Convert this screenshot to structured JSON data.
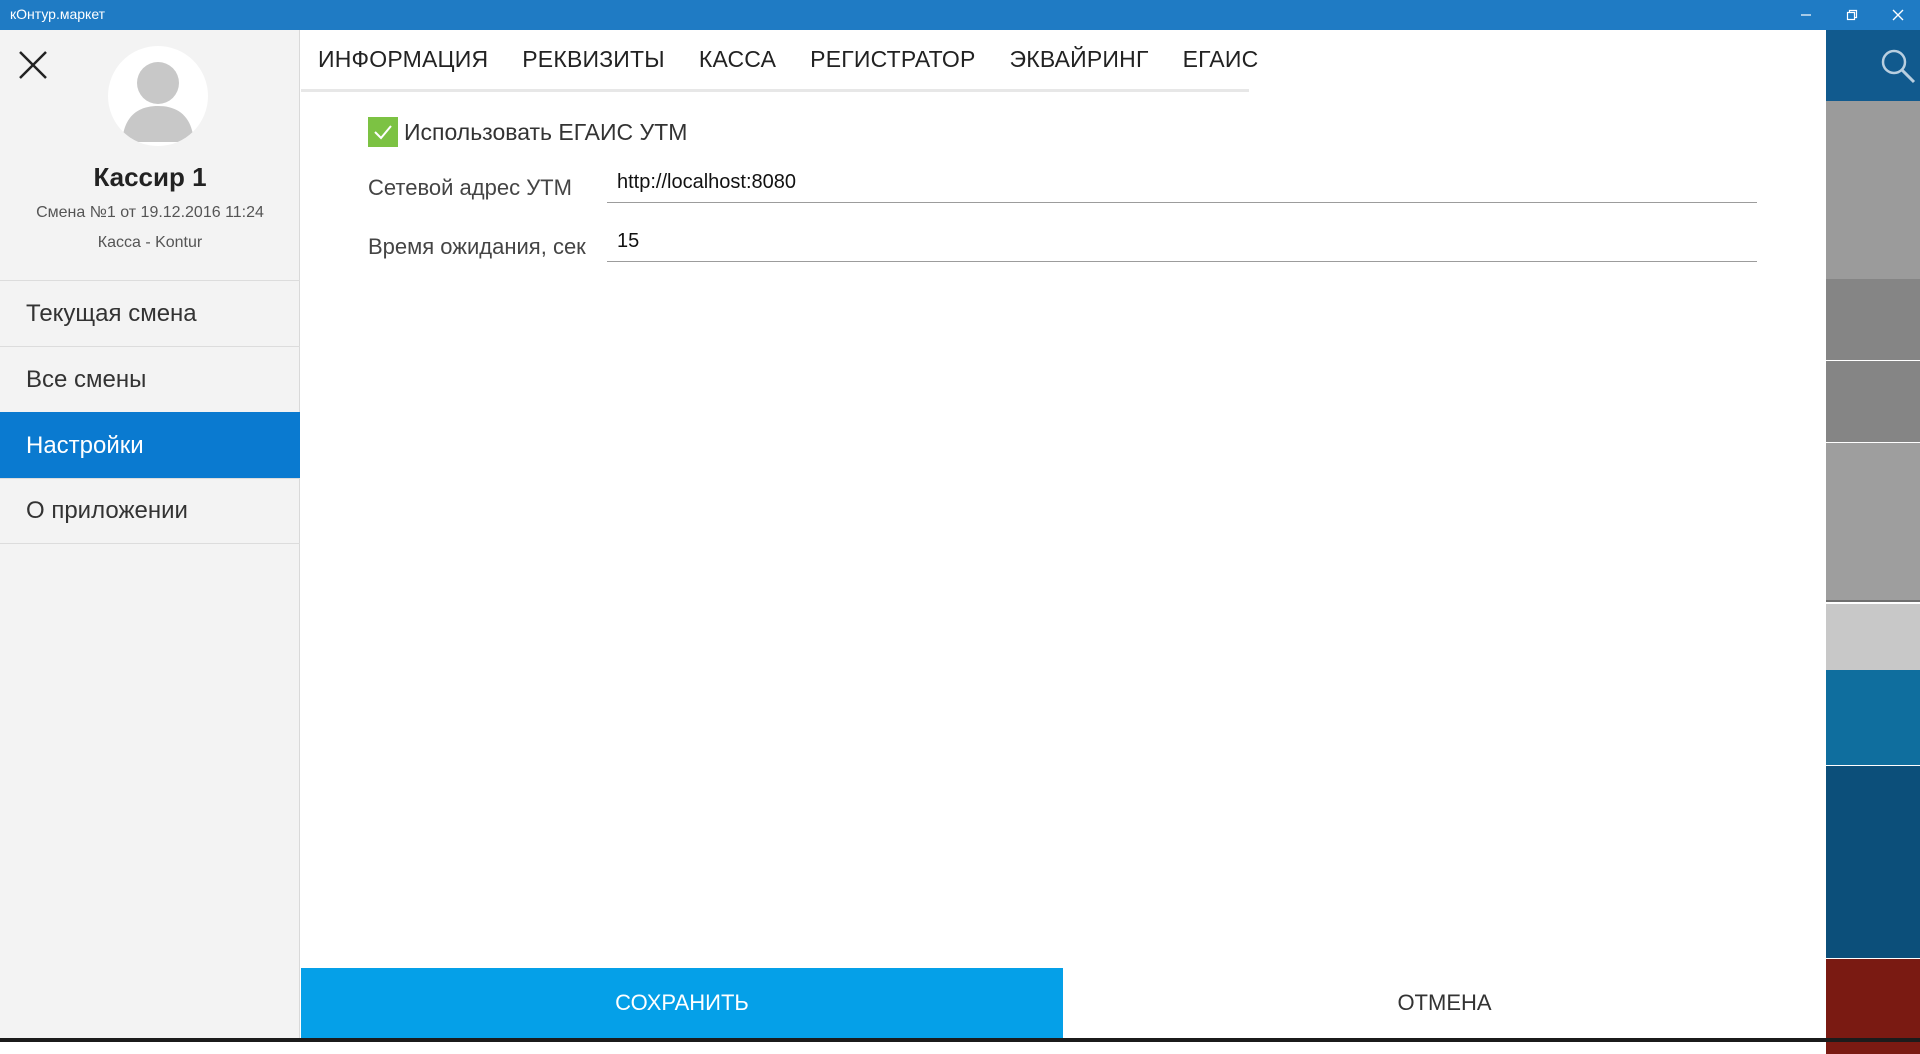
{
  "window": {
    "title": "кОнтур.маркет",
    "minimize_icon": "minimize-icon",
    "maximize_icon": "restore-icon",
    "close_icon": "close-icon"
  },
  "sidebar": {
    "close_icon": "close-x-icon",
    "avatar_icon": "user-avatar-icon",
    "cashier_name": "Кассир 1",
    "shift_info": "Смена №1 от 19.12.2016 11:24",
    "register_info": "Касса - Kontur",
    "items": [
      {
        "label": "Текущая смена",
        "active": false
      },
      {
        "label": "Все смены",
        "active": false
      },
      {
        "label": "Настройки",
        "active": true
      },
      {
        "label": "О приложении",
        "active": false
      }
    ]
  },
  "tabs": [
    "ИНФОРМАЦИЯ",
    "РЕКВИЗИТЫ",
    "КАССА",
    "РЕГИСТРАТОР",
    "ЭКВАЙРИНГ",
    "ЕГАИС"
  ],
  "egais": {
    "use_utm_checked": true,
    "use_utm_label": "Использовать ЕГАИС УТМ",
    "network_address_label": "Сетевой адрес УТМ",
    "network_address_value": "http://localhost:8080",
    "timeout_label": "Время ожидания, сек",
    "timeout_value": "15"
  },
  "footer": {
    "save_label": "СОХРАНИТЬ",
    "cancel_label": "ОТМЕНА"
  },
  "colors": {
    "titlebar": "#1f7bc4",
    "active_menu": "#0a7ad0",
    "save_button": "#05a0e8",
    "checkbox": "#7cc243"
  }
}
